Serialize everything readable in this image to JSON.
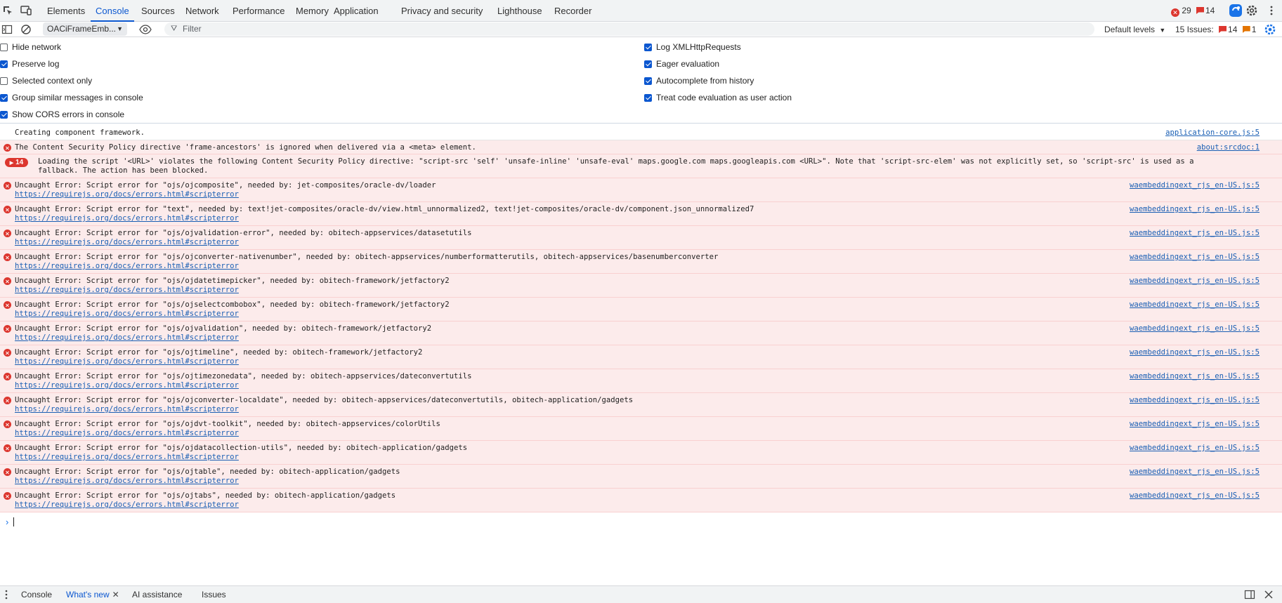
{
  "top_tabs": [
    "Elements",
    "Console",
    "Sources",
    "Network",
    "Performance",
    "Memory",
    "Application",
    "Privacy and security",
    "Lighthouse",
    "Recorder"
  ],
  "active_top_tab": "Console",
  "top_counts": {
    "errors": "29",
    "issues": "14"
  },
  "toolbar": {
    "context": "OACiFrameEmb...",
    "filter_placeholder": "Filter",
    "levels": "Default levels",
    "issues_label": "15 Issues:",
    "issues_errors": "14",
    "issues_warnings": "1"
  },
  "settings": {
    "left": [
      {
        "label": "Hide network",
        "checked": false
      },
      {
        "label": "Preserve log",
        "checked": true
      },
      {
        "label": "Selected context only",
        "checked": false
      },
      {
        "label": "Group similar messages in console",
        "checked": true
      },
      {
        "label": "Show CORS errors in console",
        "checked": true
      }
    ],
    "right": [
      {
        "label": "Log XMLHttpRequests",
        "checked": true
      },
      {
        "label": "Eager evaluation",
        "checked": true
      },
      {
        "label": "Autocomplete from history",
        "checked": true
      },
      {
        "label": "Treat code evaluation as user action",
        "checked": true
      }
    ]
  },
  "messages": [
    {
      "level": "info",
      "text": "Creating component framework.",
      "source": "application-core.js:5"
    },
    {
      "level": "error",
      "text": "The Content Security Policy directive 'frame-ancestors' is ignored when delivered via a <meta> element.",
      "source": "about:srcdoc:1"
    },
    {
      "level": "error-group",
      "count": "14",
      "text": "Loading the script '<URL>' violates the following Content Security Policy directive: \"script-src 'self' 'unsafe-inline' 'unsafe-eval' maps.google.com maps.googleapis.com <URL>\". Note that 'script-src-elem' was not explicitly set, so 'script-src' is used as a",
      "text2": "fallback. The action has been blocked.",
      "source": ""
    },
    {
      "level": "error",
      "text": "Uncaught Error: Script error for \"ojs/ojcomposite\", needed by: jet-composites/oracle-dv/loader",
      "link": "https://requirejs.org/docs/errors.html#scripterror",
      "source": "waembeddingext_rjs_en-US.js:5"
    },
    {
      "level": "error",
      "text": "Uncaught Error: Script error for \"text\", needed by: text!jet-composites/oracle-dv/view.html_unnormalized2, text!jet-composites/oracle-dv/component.json_unnormalized7",
      "link": "https://requirejs.org/docs/errors.html#scripterror",
      "source": "waembeddingext_rjs_en-US.js:5"
    },
    {
      "level": "error",
      "text": "Uncaught Error: Script error for \"ojs/ojvalidation-error\", needed by: obitech-appservices/datasetutils",
      "link": "https://requirejs.org/docs/errors.html#scripterror",
      "source": "waembeddingext_rjs_en-US.js:5"
    },
    {
      "level": "error",
      "text": "Uncaught Error: Script error for \"ojs/ojconverter-nativenumber\", needed by: obitech-appservices/numberformatterutils, obitech-appservices/basenumberconverter",
      "link": "https://requirejs.org/docs/errors.html#scripterror",
      "source": "waembeddingext_rjs_en-US.js:5"
    },
    {
      "level": "error",
      "text": "Uncaught Error: Script error for \"ojs/ojdatetimepicker\", needed by: obitech-framework/jetfactory2",
      "link": "https://requirejs.org/docs/errors.html#scripterror",
      "source": "waembeddingext_rjs_en-US.js:5"
    },
    {
      "level": "error",
      "text": "Uncaught Error: Script error for \"ojs/ojselectcombobox\", needed by: obitech-framework/jetfactory2",
      "link": "https://requirejs.org/docs/errors.html#scripterror",
      "source": "waembeddingext_rjs_en-US.js:5"
    },
    {
      "level": "error",
      "text": "Uncaught Error: Script error for \"ojs/ojvalidation\", needed by: obitech-framework/jetfactory2",
      "link": "https://requirejs.org/docs/errors.html#scripterror",
      "source": "waembeddingext_rjs_en-US.js:5"
    },
    {
      "level": "error",
      "text": "Uncaught Error: Script error for \"ojs/ojtimeline\", needed by: obitech-framework/jetfactory2",
      "link": "https://requirejs.org/docs/errors.html#scripterror",
      "source": "waembeddingext_rjs_en-US.js:5"
    },
    {
      "level": "error",
      "text": "Uncaught Error: Script error for \"ojs/ojtimezonedata\", needed by: obitech-appservices/dateconvertutils",
      "link": "https://requirejs.org/docs/errors.html#scripterror",
      "source": "waembeddingext_rjs_en-US.js:5"
    },
    {
      "level": "error",
      "text": "Uncaught Error: Script error for \"ojs/ojconverter-localdate\", needed by: obitech-appservices/dateconvertutils, obitech-application/gadgets",
      "link": "https://requirejs.org/docs/errors.html#scripterror",
      "source": "waembeddingext_rjs_en-US.js:5"
    },
    {
      "level": "error",
      "text": "Uncaught Error: Script error for \"ojs/ojdvt-toolkit\", needed by: obitech-appservices/colorUtils",
      "link": "https://requirejs.org/docs/errors.html#scripterror",
      "source": "waembeddingext_rjs_en-US.js:5"
    },
    {
      "level": "error",
      "text": "Uncaught Error: Script error for \"ojs/ojdatacollection-utils\", needed by: obitech-application/gadgets",
      "link": "https://requirejs.org/docs/errors.html#scripterror",
      "source": "waembeddingext_rjs_en-US.js:5"
    },
    {
      "level": "error",
      "text": "Uncaught Error: Script error for \"ojs/ojtable\", needed by: obitech-application/gadgets",
      "link": "https://requirejs.org/docs/errors.html#scripterror",
      "source": "waembeddingext_rjs_en-US.js:5"
    },
    {
      "level": "error",
      "text": "Uncaught Error: Script error for \"ojs/ojtabs\", needed by: obitech-application/gadgets",
      "link": "https://requirejs.org/docs/errors.html#scripterror",
      "source": "waembeddingext_rjs_en-US.js:5"
    }
  ],
  "drawer_tabs": [
    "Console",
    "What's new",
    "AI assistance",
    "Issues"
  ],
  "active_drawer_tab": "What's new",
  "colors": {
    "accent": "#0b57d0",
    "error": "#dc362e",
    "error_bg": "#fcebeb",
    "link": "#1a5fb4"
  }
}
